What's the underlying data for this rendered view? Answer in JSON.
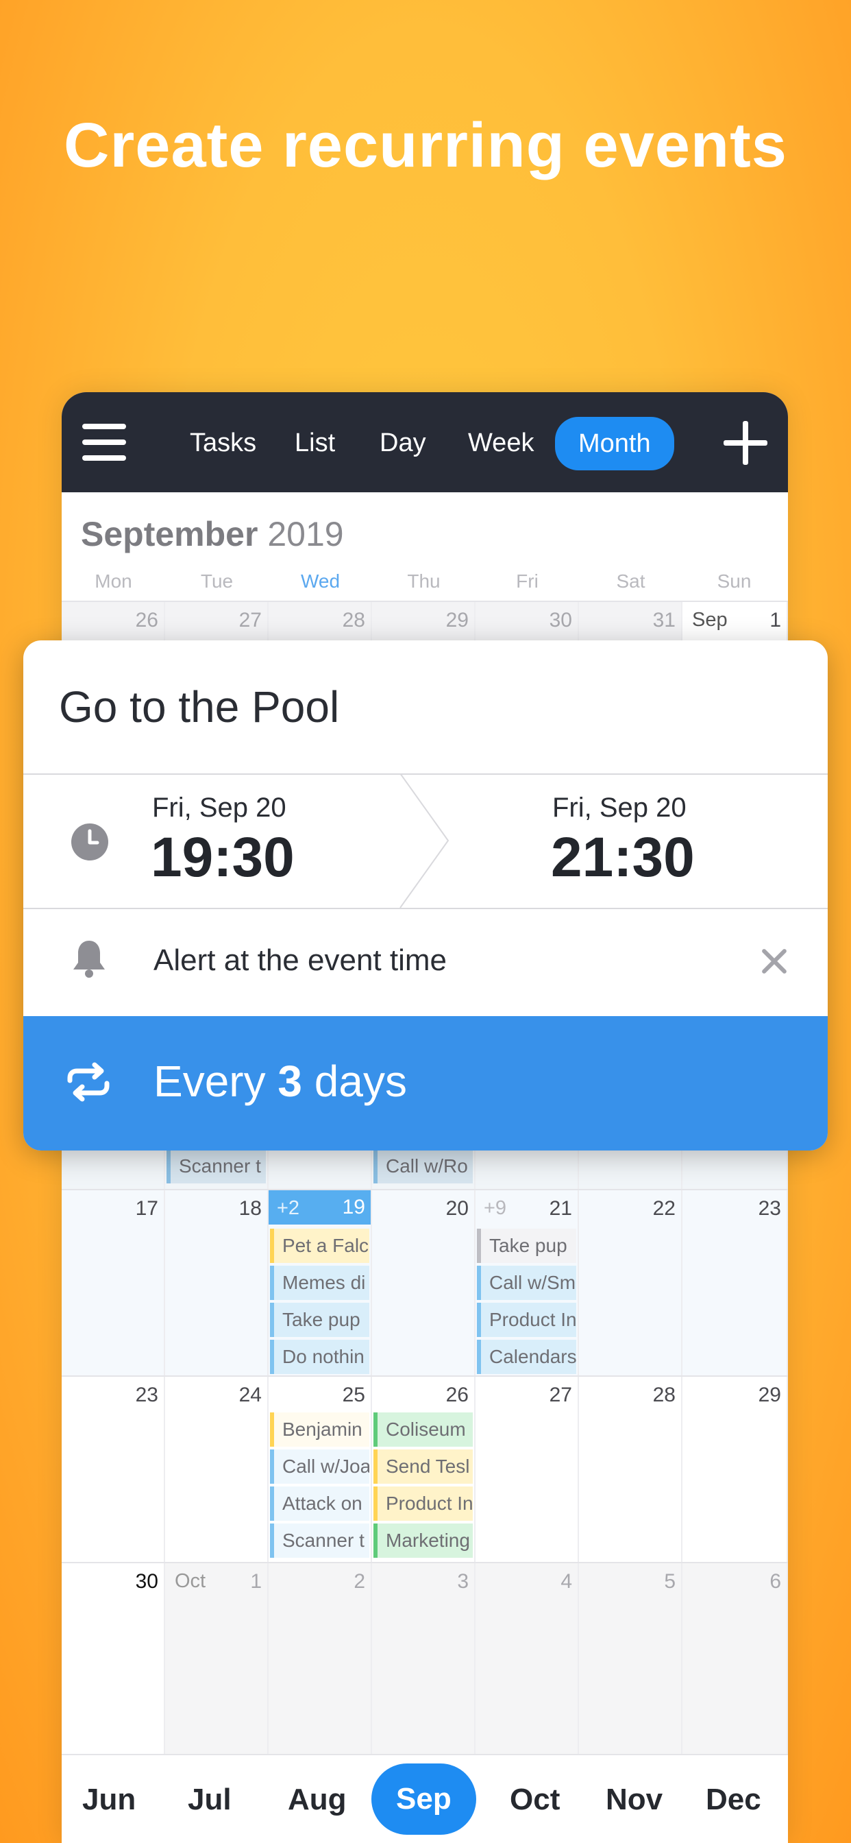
{
  "headline": "Create recurring events",
  "topbar": {
    "tabs": [
      "Tasks",
      "List",
      "Day",
      "Week",
      "Month"
    ],
    "active_tab": "Month"
  },
  "calendar": {
    "month_name": "September",
    "year": "2019",
    "weekdays": [
      "Mon",
      "Tue",
      "Wed",
      "Thu",
      "Fri",
      "Sat",
      "Sun"
    ],
    "today_weekday": "Wed",
    "week1": [
      "26",
      "27",
      "28",
      "29",
      "30",
      "31",
      "1"
    ],
    "week1_month_label": "Sep",
    "prev_week_events": [
      "Scanner t",
      "Call w/Ro"
    ],
    "week3": [
      "17",
      "18",
      "19",
      "20",
      "21",
      "22",
      "23"
    ],
    "week3_more": {
      "wed": "+2",
      "fri": "+9"
    },
    "week3_wed_events": [
      "Pet a Falc",
      "Memes di",
      "Take pup",
      "Do nothin"
    ],
    "week3_fri_events": [
      "Take pup",
      "Call w/Sm",
      "Product In",
      "Calendars"
    ],
    "week4": [
      "23",
      "24",
      "25",
      "26",
      "27",
      "28",
      "29"
    ],
    "week4_wed_events": [
      "Benjamin",
      "Call w/Joa",
      "Attack on",
      "Scanner t"
    ],
    "week4_thu_events": [
      "Coliseum",
      "Send Tesl",
      "Product In",
      "Marketing"
    ],
    "week5": [
      "30",
      "1",
      "2",
      "3",
      "4",
      "5",
      "6"
    ],
    "week5_month_label": "Oct"
  },
  "event_card": {
    "title": "Go to the Pool",
    "start_date": "Fri, Sep 20",
    "start_time": "19:30",
    "end_date": "Fri, Sep 20",
    "end_time": "21:30",
    "alert": "Alert at the event time",
    "repeat_prefix": "Every ",
    "repeat_count": "3",
    "repeat_suffix": " days"
  },
  "month_footer": [
    "Jun",
    "Jul",
    "Aug",
    "Sep",
    "Oct",
    "Nov",
    "Dec"
  ],
  "colors": {
    "background": "#FFBE3A",
    "topbar": "#272B36",
    "accent": "#1E8CF2",
    "repeat_bar": "#3891EA"
  }
}
